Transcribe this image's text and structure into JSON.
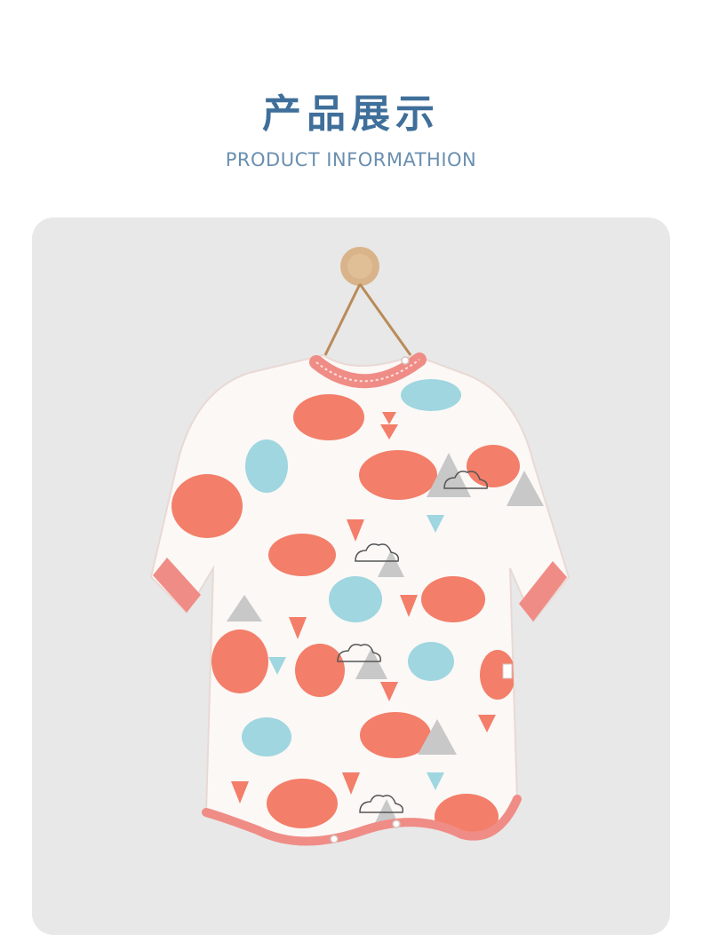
{
  "header": {
    "title": "产品展示",
    "subtitle": "PRODUCT INFORMATHION"
  },
  "product_image": {
    "subject": "baby-sleeping-gown",
    "colors": {
      "panel_bg": "#e8e8e8",
      "fabric": "#fbf8f6",
      "trim": "#f08c86",
      "coral": "#f37e69",
      "blue": "#9fd6e0",
      "gray": "#c8c8c8",
      "wood": "#d9b48a"
    }
  }
}
